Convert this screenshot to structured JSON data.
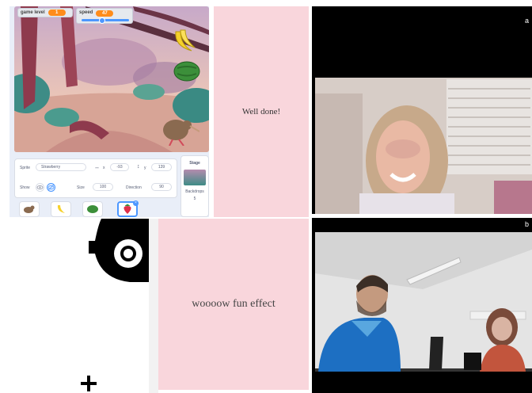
{
  "editor": {
    "monitors": [
      {
        "label": "game level",
        "value": "1"
      },
      {
        "label": "speed",
        "value": "47"
      }
    ],
    "sprite_info": {
      "sprite_label": "Sprite",
      "sprite_name": "Strawberry",
      "x_label": "x",
      "x_value": "-93",
      "y_label": "y",
      "y_value": "139",
      "show_label": "Show",
      "size_label": "Size",
      "size_value": "100",
      "direction_label": "Direction",
      "direction_value": "90"
    },
    "stage_pane": {
      "title": "Stage",
      "backdrops_label": "Backdrops",
      "backdrops_count": "5"
    },
    "sprites": [
      {
        "name": "kiwi-bird",
        "selected": false
      },
      {
        "name": "banana",
        "selected": false
      },
      {
        "name": "watermelon",
        "selected": false
      },
      {
        "name": "strawberry",
        "selected": true
      }
    ]
  },
  "messages": {
    "top": "Well done!",
    "bottom": "woooow fun effect"
  },
  "panels": {
    "a_label": "a",
    "b_label": "b"
  },
  "colors": {
    "pink_card": "#f9d6dc",
    "scratch_blue": "#4c97ff",
    "monitor_orange": "#ff8c1a"
  }
}
